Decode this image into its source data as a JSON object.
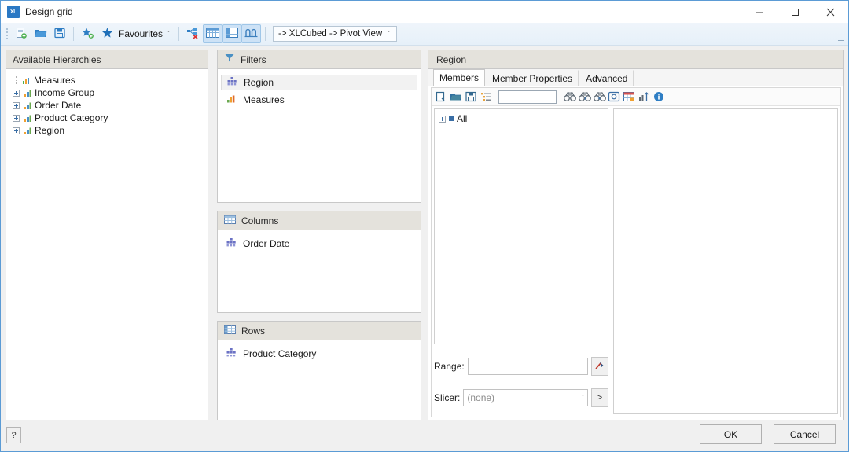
{
  "window": {
    "title": "Design grid",
    "app_icon": "xlcubed-icon",
    "controls": {
      "minimize": "minimize-icon",
      "maximize": "maximize-icon",
      "close": "close-icon"
    }
  },
  "toolbar": {
    "buttons": [
      {
        "name": "new-grid-button",
        "icon": "new-document-icon",
        "active": false
      },
      {
        "name": "open-button",
        "icon": "folder-open-icon",
        "active": false
      },
      {
        "name": "save-button",
        "icon": "floppy-save-icon",
        "active": false
      },
      {
        "name": "add-favourite-button",
        "icon": "star-add-icon",
        "active": false
      },
      {
        "name": "favourites-button",
        "icon": "star-icon",
        "active": false
      },
      {
        "name": "remove-field-button",
        "icon": "remove-field-icon",
        "active": false
      },
      {
        "name": "grid-layout-button",
        "icon": "table-grid-icon",
        "active": true
      },
      {
        "name": "column-layout-button",
        "icon": "column-grid-icon",
        "active": true
      },
      {
        "name": "chart-layout-button",
        "icon": "chart-icon",
        "active": true
      }
    ],
    "favourites_label": "Favourites",
    "favourites_caret": "ˇ",
    "path_label": "-> XLCubed  -> Pivot View",
    "path_caret": "ˇ",
    "overflow": "toolbar-overflow-icon"
  },
  "hierarchies": {
    "header": "Available Hierarchies",
    "items": [
      {
        "label": "Measures",
        "icon": "measures-icon",
        "expandable": false
      },
      {
        "label": "Income Group",
        "icon": "hierarchy-icon",
        "expandable": true
      },
      {
        "label": "Order Date",
        "icon": "hierarchy-icon",
        "expandable": true
      },
      {
        "label": "Product Category",
        "icon": "hierarchy-icon",
        "expandable": true
      },
      {
        "label": "Region",
        "icon": "hierarchy-icon",
        "expandable": true
      }
    ]
  },
  "filters": {
    "header": "Filters",
    "header_icon": "funnel-icon",
    "items": [
      {
        "label": "Region",
        "icon": "hierarchy-pyramid-icon",
        "selected": true
      },
      {
        "label": "Measures",
        "icon": "measures-bars-icon",
        "selected": false
      }
    ]
  },
  "columns": {
    "header": "Columns",
    "header_icon": "columns-grid-icon",
    "items": [
      {
        "label": "Order Date",
        "icon": "hierarchy-pyramid-icon",
        "selected": false
      }
    ]
  },
  "rows": {
    "header": "Rows",
    "header_icon": "rows-grid-icon",
    "items": [
      {
        "label": "Product Category",
        "icon": "hierarchy-pyramid-icon",
        "selected": false
      }
    ]
  },
  "region": {
    "header": "Region",
    "tabs": [
      {
        "label": "Members",
        "active": true
      },
      {
        "label": "Member Properties",
        "active": false
      },
      {
        "label": "Advanced",
        "active": false
      }
    ],
    "member_toolbar": [
      {
        "name": "new-selection-button",
        "icon": "new-page-icon"
      },
      {
        "name": "open-selection-button",
        "icon": "folder-open-icon"
      },
      {
        "name": "save-selection-button",
        "icon": "floppy-save-icon"
      },
      {
        "name": "list-view-button",
        "icon": "list-indent-icon"
      }
    ],
    "search_value": "",
    "member_toolbar_right": [
      {
        "name": "find-button",
        "icon": "binoculars-icon"
      },
      {
        "name": "find-next-button",
        "icon": "binoculars-next-icon"
      },
      {
        "name": "find-prev-button",
        "icon": "binoculars-prev-icon"
      },
      {
        "name": "select-visible-button",
        "icon": "select-box-icon"
      },
      {
        "name": "grid-select-button",
        "icon": "grid-select-icon"
      },
      {
        "name": "sort-button",
        "icon": "sort-ascending-icon"
      },
      {
        "name": "info-button",
        "icon": "info-icon"
      }
    ],
    "tree": [
      {
        "label": "All",
        "expandable": true
      }
    ],
    "range_label": "Range:",
    "range_value": "",
    "range_picker_icon": "range-picker-icon",
    "slicer_label": "Slicer:",
    "slicer_value": "(none)",
    "slicer_caret": "ˇ",
    "slicer_go_label": ">"
  },
  "footer": {
    "help_label": "?",
    "ok_label": "OK",
    "cancel_label": "Cancel"
  }
}
